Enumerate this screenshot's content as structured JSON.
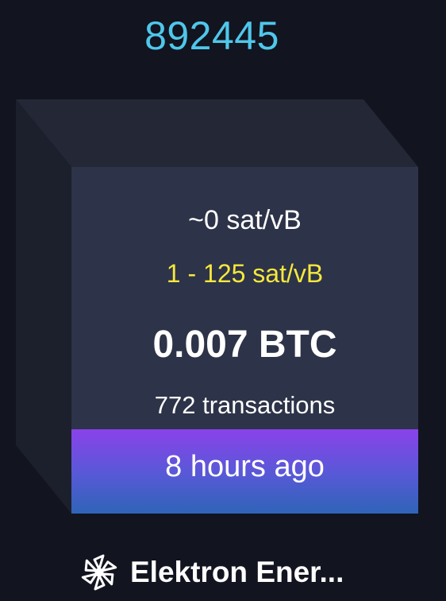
{
  "block": {
    "height": "892445",
    "median_fee": "~0 sat/vB",
    "fee_span": "1 - 125 sat/vB",
    "total_fees": "0.007 BTC",
    "transactions": "772 transactions",
    "time_ago": "8 hours ago"
  },
  "pool": {
    "name": "Elektron Ener...",
    "icon": "pinwheel-icon"
  },
  "colors": {
    "background": "#121420",
    "height_link": "#4fc7ea",
    "cube_front": "#2d3348",
    "cube_side": "#1c202c",
    "cube_top": "#232736",
    "fee_span": "#f5e83d",
    "time_gradient_top": "#8a42ea",
    "time_gradient_bottom": "#2f64b8"
  }
}
